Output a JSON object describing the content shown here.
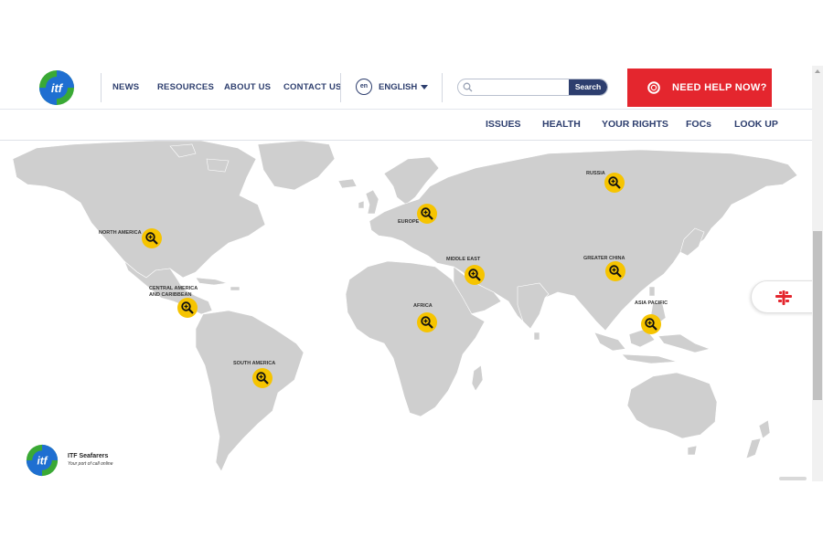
{
  "header": {
    "nav": [
      {
        "label": "NEWS"
      },
      {
        "label": "RESOURCES"
      },
      {
        "label": "ABOUT US"
      },
      {
        "label": "CONTACT US"
      }
    ],
    "language": {
      "code": "en",
      "label": "ENGLISH"
    },
    "search": {
      "placeholder": "",
      "button_label": "Search"
    },
    "help_button": "NEED HELP NOW?",
    "logo_text": "itf"
  },
  "subnav": [
    {
      "label": "ISSUES"
    },
    {
      "label": "HEALTH"
    },
    {
      "label": "YOUR RIGHTS"
    },
    {
      "label": "FOCs"
    },
    {
      "label": "LOOK UP"
    }
  ],
  "map": {
    "regions": [
      {
        "key": "russia",
        "label": "RUSSIA"
      },
      {
        "key": "europe",
        "label": "EUROPE"
      },
      {
        "key": "north_america",
        "label": "NORTH AMERICA"
      },
      {
        "key": "middle_east",
        "label": "MIDDLE EAST"
      },
      {
        "key": "greater_china",
        "label": "GREATER CHINA"
      },
      {
        "key": "central_america",
        "label": "CENTRAL AMERICA AND CARIBBEAN"
      },
      {
        "key": "asia_pacific",
        "label": "ASIA PACIFIC"
      },
      {
        "key": "africa",
        "label": "AFRICA"
      },
      {
        "key": "south_america",
        "label": "SOUTH AMERICA"
      }
    ],
    "land_color": "#cfcfcf",
    "marker_color": "#f6c400"
  },
  "brand": {
    "name": "ITF Seafarers",
    "tagline": "Your port of call online",
    "logo_text": "itf"
  },
  "colors": {
    "navy": "#2d3e6e",
    "red": "#e4262e",
    "logo_green": "#3aa935",
    "logo_blue": "#1f6fd1"
  }
}
